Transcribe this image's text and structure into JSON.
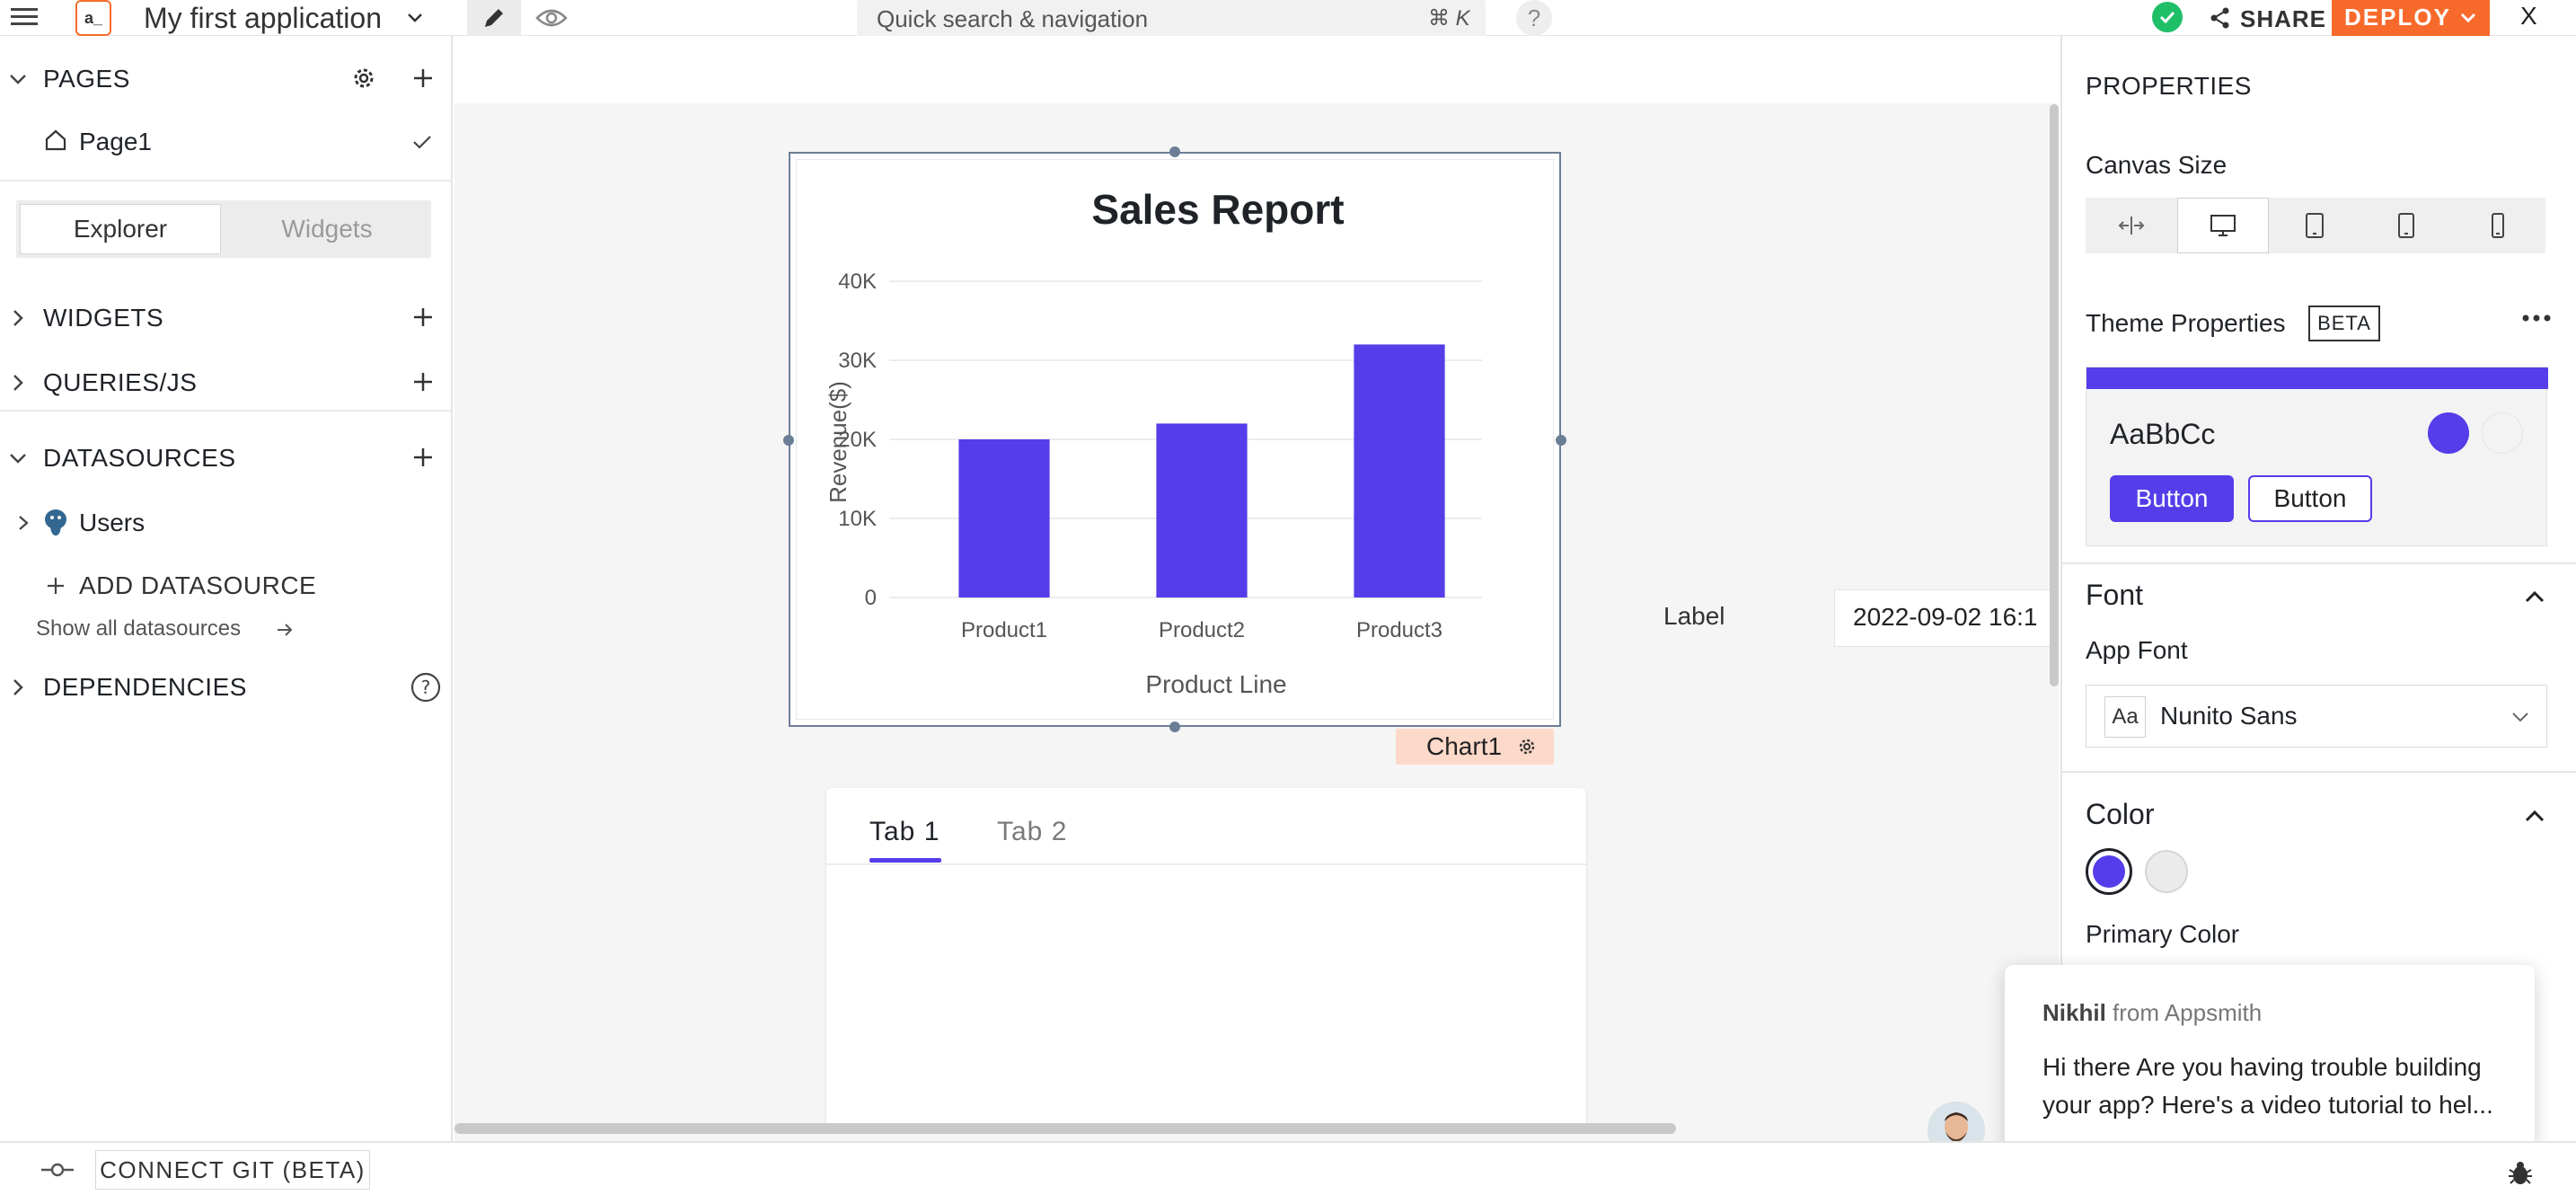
{
  "header": {
    "app_name": "My first application",
    "logo_text": "a_",
    "search_placeholder": "Quick search & navigation",
    "search_shortcut": "⌘ K",
    "help_label": "?",
    "share_label": "SHARE",
    "deploy_label": "DEPLOY",
    "close_label": "X"
  },
  "sidebar": {
    "pages_title": "PAGES",
    "page_item": "Page1",
    "segment": {
      "explorer": "Explorer",
      "widgets": "Widgets"
    },
    "widgets_title": "WIDGETS",
    "queries_title": "QUERIES/JS",
    "datasources_title": "DATASOURCES",
    "datasource_item": "Users",
    "add_datasource": "ADD DATASOURCE",
    "show_all_datasources": "Show all datasources",
    "dependencies_title": "DEPENDENCIES"
  },
  "canvas": {
    "chart_tag": "Chart1",
    "tabs": [
      "Tab 1",
      "Tab 2"
    ],
    "datepicker_label": "Label",
    "datepicker_value": "2022-09-02 16:1"
  },
  "chart_data": {
    "type": "bar",
    "title": "Sales Report",
    "xlabel": "Product Line",
    "ylabel": "Revenue($)",
    "categories": [
      "Product1",
      "Product2",
      "Product3"
    ],
    "values": [
      20000,
      22000,
      32000
    ],
    "ylim": [
      0,
      40000
    ],
    "yticks": [
      "0",
      "10K",
      "20K",
      "30K",
      "40K"
    ],
    "bar_color": "#553de9",
    "grid": true
  },
  "properties": {
    "title": "PROPERTIES",
    "canvas_size_label": "Canvas Size",
    "theme_properties_label": "Theme Properties",
    "beta_label": "BETA",
    "theme_preview_text": "AaBbCc",
    "theme_button_primary": "Button",
    "theme_button_secondary": "Button",
    "font_section": "Font",
    "app_font_label": "App Font",
    "app_font_icon_text": "Aa",
    "app_font_value": "Nunito Sans",
    "color_section": "Color",
    "primary_color_label": "Primary Color",
    "primary_color": "#553de9"
  },
  "chat": {
    "sender": "Nikhil",
    "from_text": " from Appsmith",
    "message_line1": "Hi there Are you having trouble building",
    "message_line2": "your app? Here's a video tutorial to hel..."
  },
  "footer": {
    "connect_git": "CONNECT GIT (BETA)"
  }
}
